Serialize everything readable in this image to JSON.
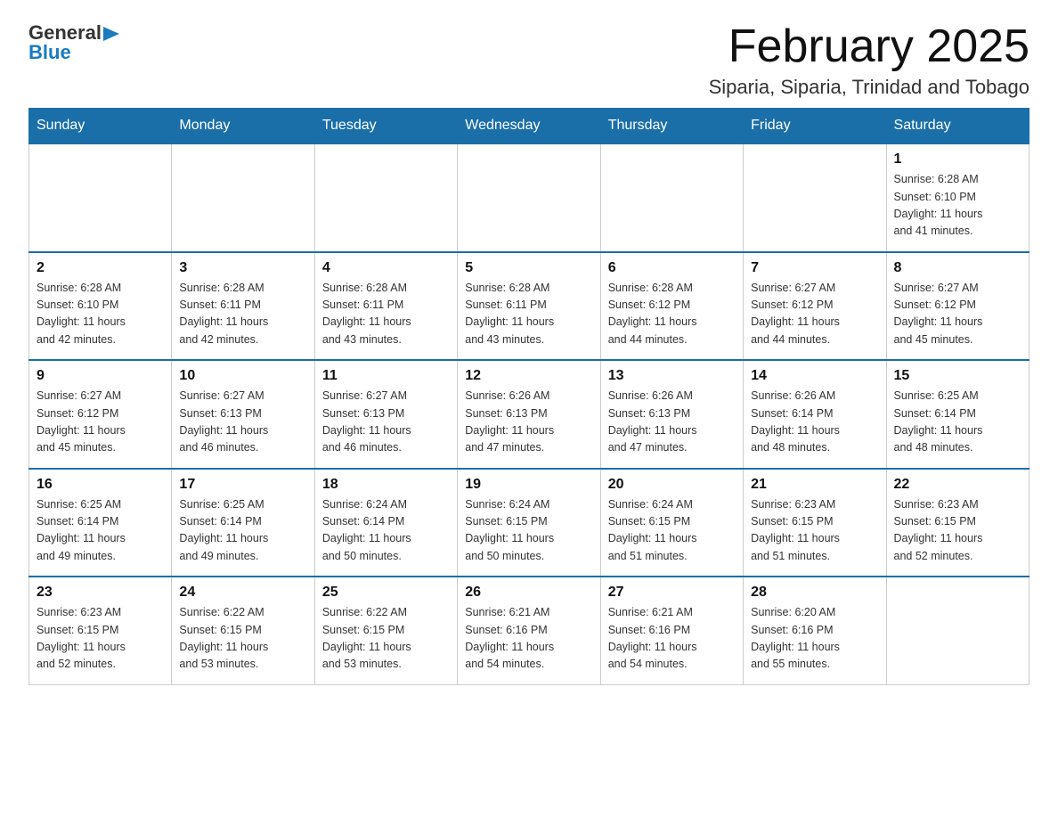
{
  "logo": {
    "general": "General",
    "blue": "Blue",
    "arrow": "▶"
  },
  "header": {
    "month_title": "February 2025",
    "location": "Siparia, Siparia, Trinidad and Tobago"
  },
  "days_of_week": [
    "Sunday",
    "Monday",
    "Tuesday",
    "Wednesday",
    "Thursday",
    "Friday",
    "Saturday"
  ],
  "weeks": [
    {
      "days": [
        {
          "num": "",
          "info": ""
        },
        {
          "num": "",
          "info": ""
        },
        {
          "num": "",
          "info": ""
        },
        {
          "num": "",
          "info": ""
        },
        {
          "num": "",
          "info": ""
        },
        {
          "num": "",
          "info": ""
        },
        {
          "num": "1",
          "info": "Sunrise: 6:28 AM\nSunset: 6:10 PM\nDaylight: 11 hours\nand 41 minutes."
        }
      ]
    },
    {
      "days": [
        {
          "num": "2",
          "info": "Sunrise: 6:28 AM\nSunset: 6:10 PM\nDaylight: 11 hours\nand 42 minutes."
        },
        {
          "num": "3",
          "info": "Sunrise: 6:28 AM\nSunset: 6:11 PM\nDaylight: 11 hours\nand 42 minutes."
        },
        {
          "num": "4",
          "info": "Sunrise: 6:28 AM\nSunset: 6:11 PM\nDaylight: 11 hours\nand 43 minutes."
        },
        {
          "num": "5",
          "info": "Sunrise: 6:28 AM\nSunset: 6:11 PM\nDaylight: 11 hours\nand 43 minutes."
        },
        {
          "num": "6",
          "info": "Sunrise: 6:28 AM\nSunset: 6:12 PM\nDaylight: 11 hours\nand 44 minutes."
        },
        {
          "num": "7",
          "info": "Sunrise: 6:27 AM\nSunset: 6:12 PM\nDaylight: 11 hours\nand 44 minutes."
        },
        {
          "num": "8",
          "info": "Sunrise: 6:27 AM\nSunset: 6:12 PM\nDaylight: 11 hours\nand 45 minutes."
        }
      ]
    },
    {
      "days": [
        {
          "num": "9",
          "info": "Sunrise: 6:27 AM\nSunset: 6:12 PM\nDaylight: 11 hours\nand 45 minutes."
        },
        {
          "num": "10",
          "info": "Sunrise: 6:27 AM\nSunset: 6:13 PM\nDaylight: 11 hours\nand 46 minutes."
        },
        {
          "num": "11",
          "info": "Sunrise: 6:27 AM\nSunset: 6:13 PM\nDaylight: 11 hours\nand 46 minutes."
        },
        {
          "num": "12",
          "info": "Sunrise: 6:26 AM\nSunset: 6:13 PM\nDaylight: 11 hours\nand 47 minutes."
        },
        {
          "num": "13",
          "info": "Sunrise: 6:26 AM\nSunset: 6:13 PM\nDaylight: 11 hours\nand 47 minutes."
        },
        {
          "num": "14",
          "info": "Sunrise: 6:26 AM\nSunset: 6:14 PM\nDaylight: 11 hours\nand 48 minutes."
        },
        {
          "num": "15",
          "info": "Sunrise: 6:25 AM\nSunset: 6:14 PM\nDaylight: 11 hours\nand 48 minutes."
        }
      ]
    },
    {
      "days": [
        {
          "num": "16",
          "info": "Sunrise: 6:25 AM\nSunset: 6:14 PM\nDaylight: 11 hours\nand 49 minutes."
        },
        {
          "num": "17",
          "info": "Sunrise: 6:25 AM\nSunset: 6:14 PM\nDaylight: 11 hours\nand 49 minutes."
        },
        {
          "num": "18",
          "info": "Sunrise: 6:24 AM\nSunset: 6:14 PM\nDaylight: 11 hours\nand 50 minutes."
        },
        {
          "num": "19",
          "info": "Sunrise: 6:24 AM\nSunset: 6:15 PM\nDaylight: 11 hours\nand 50 minutes."
        },
        {
          "num": "20",
          "info": "Sunrise: 6:24 AM\nSunset: 6:15 PM\nDaylight: 11 hours\nand 51 minutes."
        },
        {
          "num": "21",
          "info": "Sunrise: 6:23 AM\nSunset: 6:15 PM\nDaylight: 11 hours\nand 51 minutes."
        },
        {
          "num": "22",
          "info": "Sunrise: 6:23 AM\nSunset: 6:15 PM\nDaylight: 11 hours\nand 52 minutes."
        }
      ]
    },
    {
      "days": [
        {
          "num": "23",
          "info": "Sunrise: 6:23 AM\nSunset: 6:15 PM\nDaylight: 11 hours\nand 52 minutes."
        },
        {
          "num": "24",
          "info": "Sunrise: 6:22 AM\nSunset: 6:15 PM\nDaylight: 11 hours\nand 53 minutes."
        },
        {
          "num": "25",
          "info": "Sunrise: 6:22 AM\nSunset: 6:15 PM\nDaylight: 11 hours\nand 53 minutes."
        },
        {
          "num": "26",
          "info": "Sunrise: 6:21 AM\nSunset: 6:16 PM\nDaylight: 11 hours\nand 54 minutes."
        },
        {
          "num": "27",
          "info": "Sunrise: 6:21 AM\nSunset: 6:16 PM\nDaylight: 11 hours\nand 54 minutes."
        },
        {
          "num": "28",
          "info": "Sunrise: 6:20 AM\nSunset: 6:16 PM\nDaylight: 11 hours\nand 55 minutes."
        },
        {
          "num": "",
          "info": ""
        }
      ]
    }
  ]
}
